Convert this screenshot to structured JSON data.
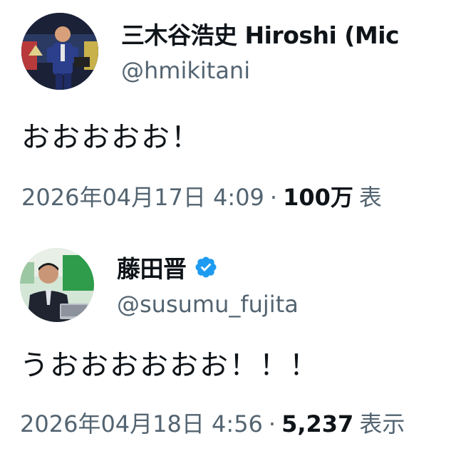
{
  "tweets": [
    {
      "author_name": "三木谷浩史 Hiroshi (Mic",
      "handle": "@hmikitani",
      "verified": false,
      "text": "おおおおお！",
      "date": "2026年04月17日 4:09",
      "separator": "·",
      "views_count": "100万",
      "views_label": "表"
    },
    {
      "author_name": "藤田晋",
      "handle": "@susumu_fujita",
      "verified": true,
      "text": "うおおおおおお！！！",
      "date": "2026年04月18日 4:56",
      "separator": "·",
      "views_count": "5,237",
      "views_label": "表示"
    }
  ],
  "colors": {
    "text_primary": "#0f1419",
    "text_secondary": "#536471",
    "verified_blue": "#1d9bf0"
  },
  "icons": {
    "verified": "verified-badge-icon"
  }
}
